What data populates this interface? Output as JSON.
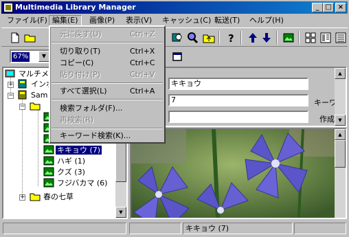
{
  "window": {
    "title": "Multimedia Library Manager",
    "buttons": [
      "_",
      "□",
      "×"
    ]
  },
  "menubar": [
    {
      "label": "ファイル(F)"
    },
    {
      "label": "編集(E)"
    },
    {
      "label": "画像(P)"
    },
    {
      "label": "表示(V)"
    },
    {
      "label": "キャッシュ(C)"
    },
    {
      "label": "転送(T)"
    },
    {
      "label": "ヘルプ(H)"
    }
  ],
  "edit_menu": {
    "items": [
      {
        "label": "元に戻す(U)",
        "shortcut": "Ctrl+Z",
        "enabled": false
      },
      {
        "label": "切り取り(T)",
        "shortcut": "Ctrl+X",
        "enabled": true
      },
      {
        "label": "コピー(C)",
        "shortcut": "Ctrl+C",
        "enabled": true
      },
      {
        "label": "貼り付け(P)",
        "shortcut": "Ctrl+V",
        "enabled": false
      },
      {
        "label": "すべて選択(L)",
        "shortcut": "Ctrl+A",
        "enabled": true
      },
      {
        "label": "検索フォルダ(F)...",
        "shortcut": "",
        "enabled": true
      },
      {
        "label": "再検索(R)",
        "shortcut": "",
        "enabled": false
      },
      {
        "label": "キーワード検索(K)...",
        "shortcut": "",
        "enabled": true
      }
    ]
  },
  "toolbar2": {
    "zoom_value": "67%"
  },
  "tree": {
    "root": "マルチメディ",
    "n1": "インポ",
    "n2": "Sam",
    "items": [
      {
        "label": "キキョウ (7)"
      },
      {
        "label": "ハギ (1)"
      },
      {
        "label": "クズ (3)"
      },
      {
        "label": "フジバカマ (6)"
      }
    ],
    "last": "春の七草"
  },
  "properties": {
    "name_value": "キキョウ",
    "count_value": "7",
    "third_value": "",
    "labels": [
      "キーワ",
      "作成"
    ]
  },
  "status": {
    "selected": "キキョウ (7)"
  },
  "colors": {
    "accent": "#000080",
    "face": "#c0c0c0",
    "flower": "#5a55c8"
  }
}
